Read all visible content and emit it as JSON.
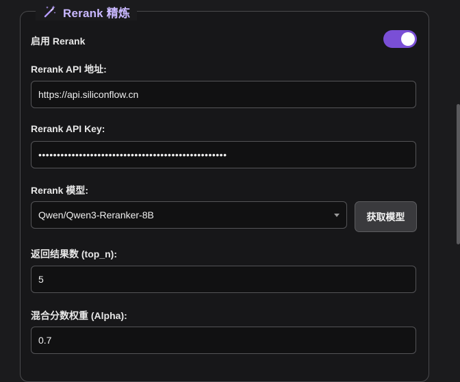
{
  "section": {
    "icon": "magic-wand-icon",
    "title": "Rerank 精炼"
  },
  "enable": {
    "label": "启用 Rerank",
    "enabled": true
  },
  "api_url": {
    "label": "Rerank API 地址:",
    "value": "https://api.siliconflow.cn"
  },
  "api_key": {
    "label": "Rerank API Key:",
    "value": "•••••••••••••••••••••••••••••••••••••••••••••••••••"
  },
  "model": {
    "label": "Rerank 模型:",
    "selected": "Qwen/Qwen3-Reranker-8B",
    "fetch_button": "获取模型"
  },
  "top_n": {
    "label": "返回结果数 (top_n):",
    "value": "5"
  },
  "alpha": {
    "label": "混合分数权重 (Alpha):",
    "value": "0.7"
  },
  "colors": {
    "accent": "#7a4fd6",
    "title": "#c9b8ff",
    "background": "#1b1b1d"
  }
}
